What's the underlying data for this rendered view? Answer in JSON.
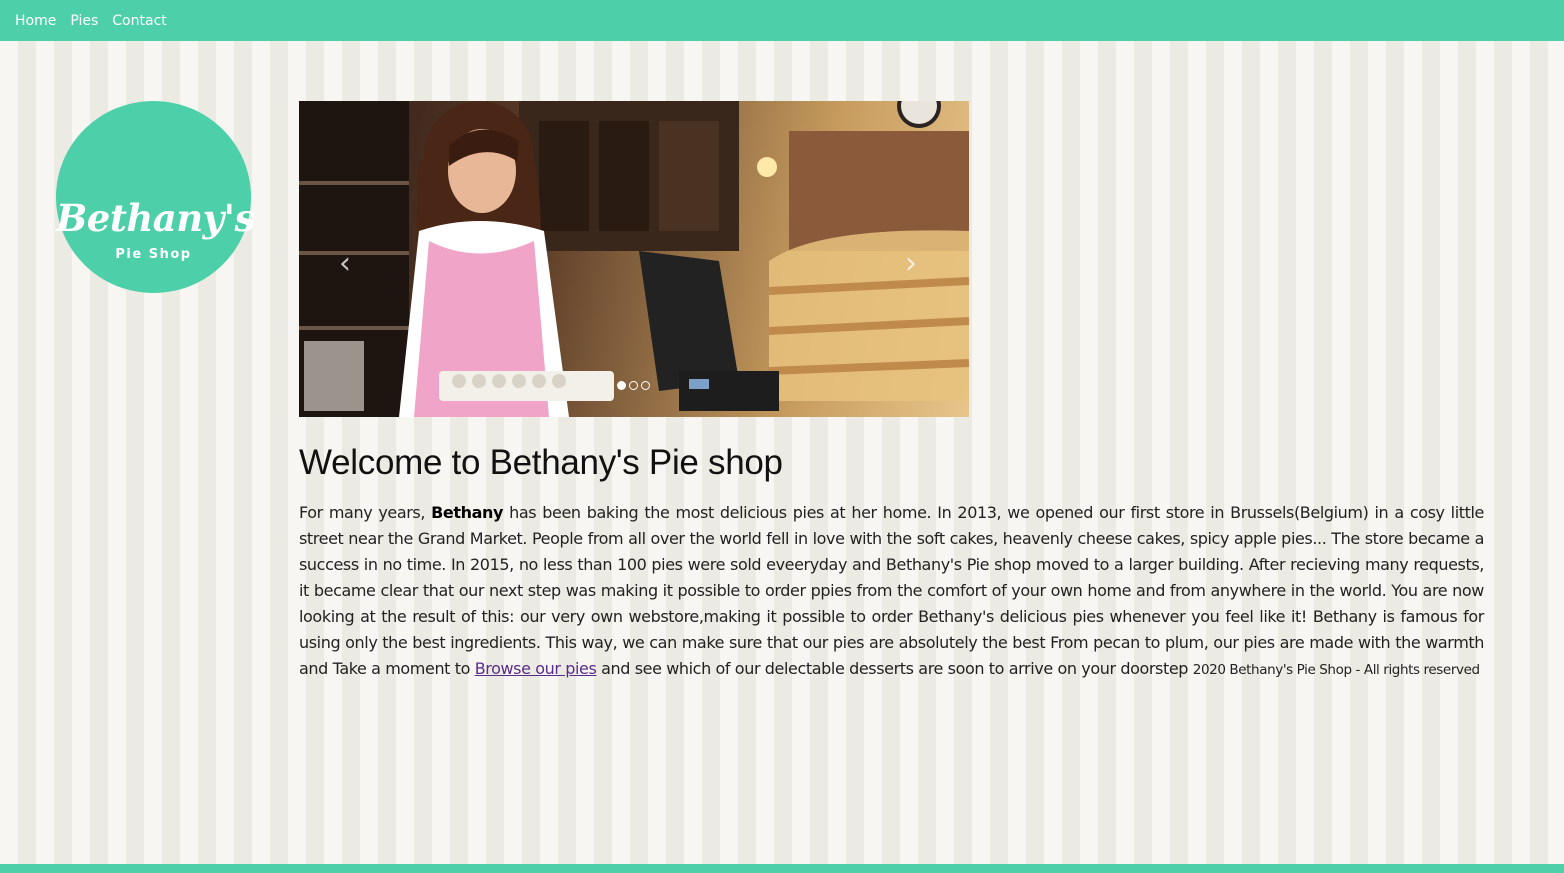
{
  "nav": {
    "items": [
      {
        "label": "Home"
      },
      {
        "label": "Pies"
      },
      {
        "label": "Contact"
      }
    ]
  },
  "logo": {
    "name": "Bethany's",
    "subtitle": "Pie Shop"
  },
  "carousel": {
    "prev_icon": "chevron-left-icon",
    "next_icon": "chevron-right-icon",
    "prev_glyph": "‹",
    "next_glyph": "›",
    "slide_count": 3,
    "active_index": 0
  },
  "main": {
    "title": "Welcome to Bethany's Pie shop",
    "intro_lead": "For many years, ",
    "intro_bold": "Bethany",
    "intro_body": " has been baking the most delicious pies at her home. In 2013, we opened our first store in Brussels(Belgium) in a cosy little street near the Grand Market. People from all over the world fell in love with the soft cakes, heavenly cheese cakes, spicy apple pies... The store became a success in no time. In 2015, no less than 100 pies were sold eveeryday and Bethany's Pie shop moved to a larger building. After recieving many requests, it became clear that our next step was making it possible to order ppies from the comfort of your own home and from anywhere in the world. You are now looking at the result of this: our very own webstore,making it possible to order Bethany's delicious pies whenever you feel like it! Bethany is famous for using only the best ingredients. This way, we can make sure that our pies are absolutely the best From pecan to plum, our pies are made with the warmth and Take a moment to ",
    "browse_link": "Browse our pies",
    "intro_tail": " and see which of our delectable desserts are soon to arrive on your doorstep ",
    "footer_text": "2020 Bethany's Pie Shop - All rights reserved"
  },
  "colors": {
    "brand": "#4dd0a9",
    "stripe_light": "#f8f6f2",
    "stripe_dark": "#ecebe3",
    "link": "#5a2c8a"
  }
}
